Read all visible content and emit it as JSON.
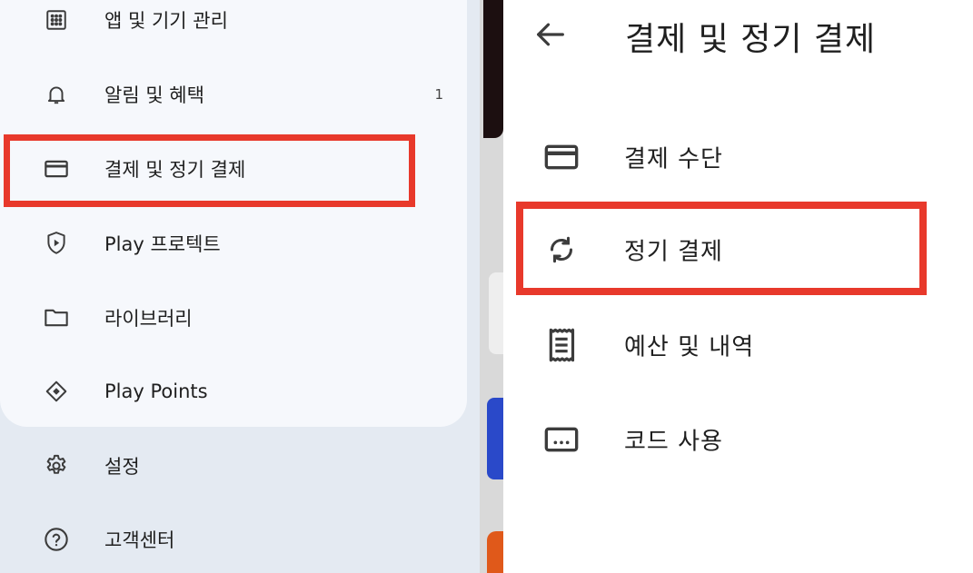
{
  "left_menu": {
    "items": [
      {
        "label": "앱 및 기기 관리",
        "icon": "grid-icon"
      },
      {
        "label": "알림 및 혜택",
        "icon": "bell-icon",
        "badge": "1"
      },
      {
        "label": "결제 및 정기 결제",
        "icon": "credit-card-icon"
      },
      {
        "label": "Play 프로텍트",
        "icon": "shield-play-icon"
      },
      {
        "label": "라이브러리",
        "icon": "folder-icon"
      },
      {
        "label": "Play Points",
        "icon": "diamond-icon"
      }
    ],
    "bottom_items": [
      {
        "label": "설정",
        "icon": "gear-icon"
      },
      {
        "label": "고객센터",
        "icon": "help-icon"
      }
    ]
  },
  "right_page": {
    "title": "결제 및 정기 결제",
    "items": [
      {
        "label": "결제 수단",
        "icon": "credit-card-icon"
      },
      {
        "label": "정기 결제",
        "icon": "sync-icon"
      },
      {
        "label": "예산 및 내역",
        "icon": "receipt-icon"
      },
      {
        "label": "코드 사용",
        "icon": "code-card-icon"
      }
    ]
  },
  "colors": {
    "highlight": "#e8392b",
    "drawer_bg": "#f6f8fc",
    "panel_bg": "#e4eaf2",
    "text": "#1f1f1f"
  }
}
